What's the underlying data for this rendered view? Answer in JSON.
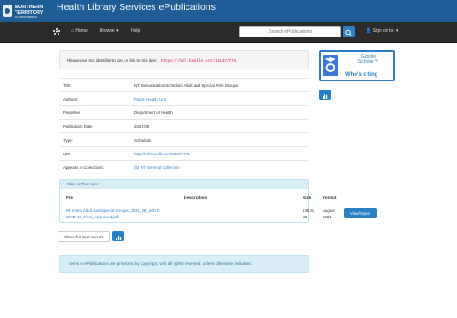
{
  "header": {
    "logo_lines": [
      "NORTHERN",
      "TERRITORY",
      "GOVERNMENT"
    ],
    "site_title": "Health Library Services ePublications"
  },
  "nav": {
    "home": "Home",
    "browse": "Browse",
    "help": "Help",
    "search_placeholder": "Search ePublications",
    "sign_in": "Sign on to:"
  },
  "identifier": {
    "prompt": "Please use this identifier to cite or link to this item:",
    "handle": "https://hdl.handle.net/10137/775"
  },
  "metadata": [
    {
      "label": "Title:",
      "value": "NT Immunisation Schedule Adult and Special Risk Groups",
      "link": false
    },
    {
      "label": "Authors:",
      "value": "Public Health Unit",
      "link": true
    },
    {
      "label": "Publisher:",
      "value": "Department of Health",
      "link": false
    },
    {
      "label": "Publication Date:",
      "value": "2021-08",
      "link": false
    },
    {
      "label": "Type:",
      "value": "Schedule",
      "link": false
    },
    {
      "label": "URI:",
      "value": "http://hdl.handle.net/10137/775",
      "link": true
    },
    {
      "label": "Appears in Collections:",
      "value": "(b) NT General Collection",
      "link": true
    }
  ],
  "files": {
    "heading": "Files in This Item:",
    "columns": {
      "file": "File",
      "description": "Description",
      "size": "Size",
      "format": "Format"
    },
    "row": {
      "file_line1": "NT Immu Adult and Special Groups_2021_08_with C",
      "file_line2": "OVID-19_Final_Approved.pdf",
      "description": "",
      "size_line1": "138.62",
      "size_line2": "kB",
      "format_line1": "August",
      "format_line2": "2021",
      "action": "View/Open"
    }
  },
  "show_full": "Show full item record",
  "copyright": "Items in ePublications are protected by copyright, with all rights reserved, unless otherwise indicated.",
  "scholar": {
    "line1": "Google",
    "line2": "Scholar™",
    "cite": "Who's citing"
  },
  "colors": {
    "brand": "#1f5d97",
    "accent": "#2a80c4",
    "navbar": "#2b2b2b",
    "info_bg": "#d9edf7"
  }
}
